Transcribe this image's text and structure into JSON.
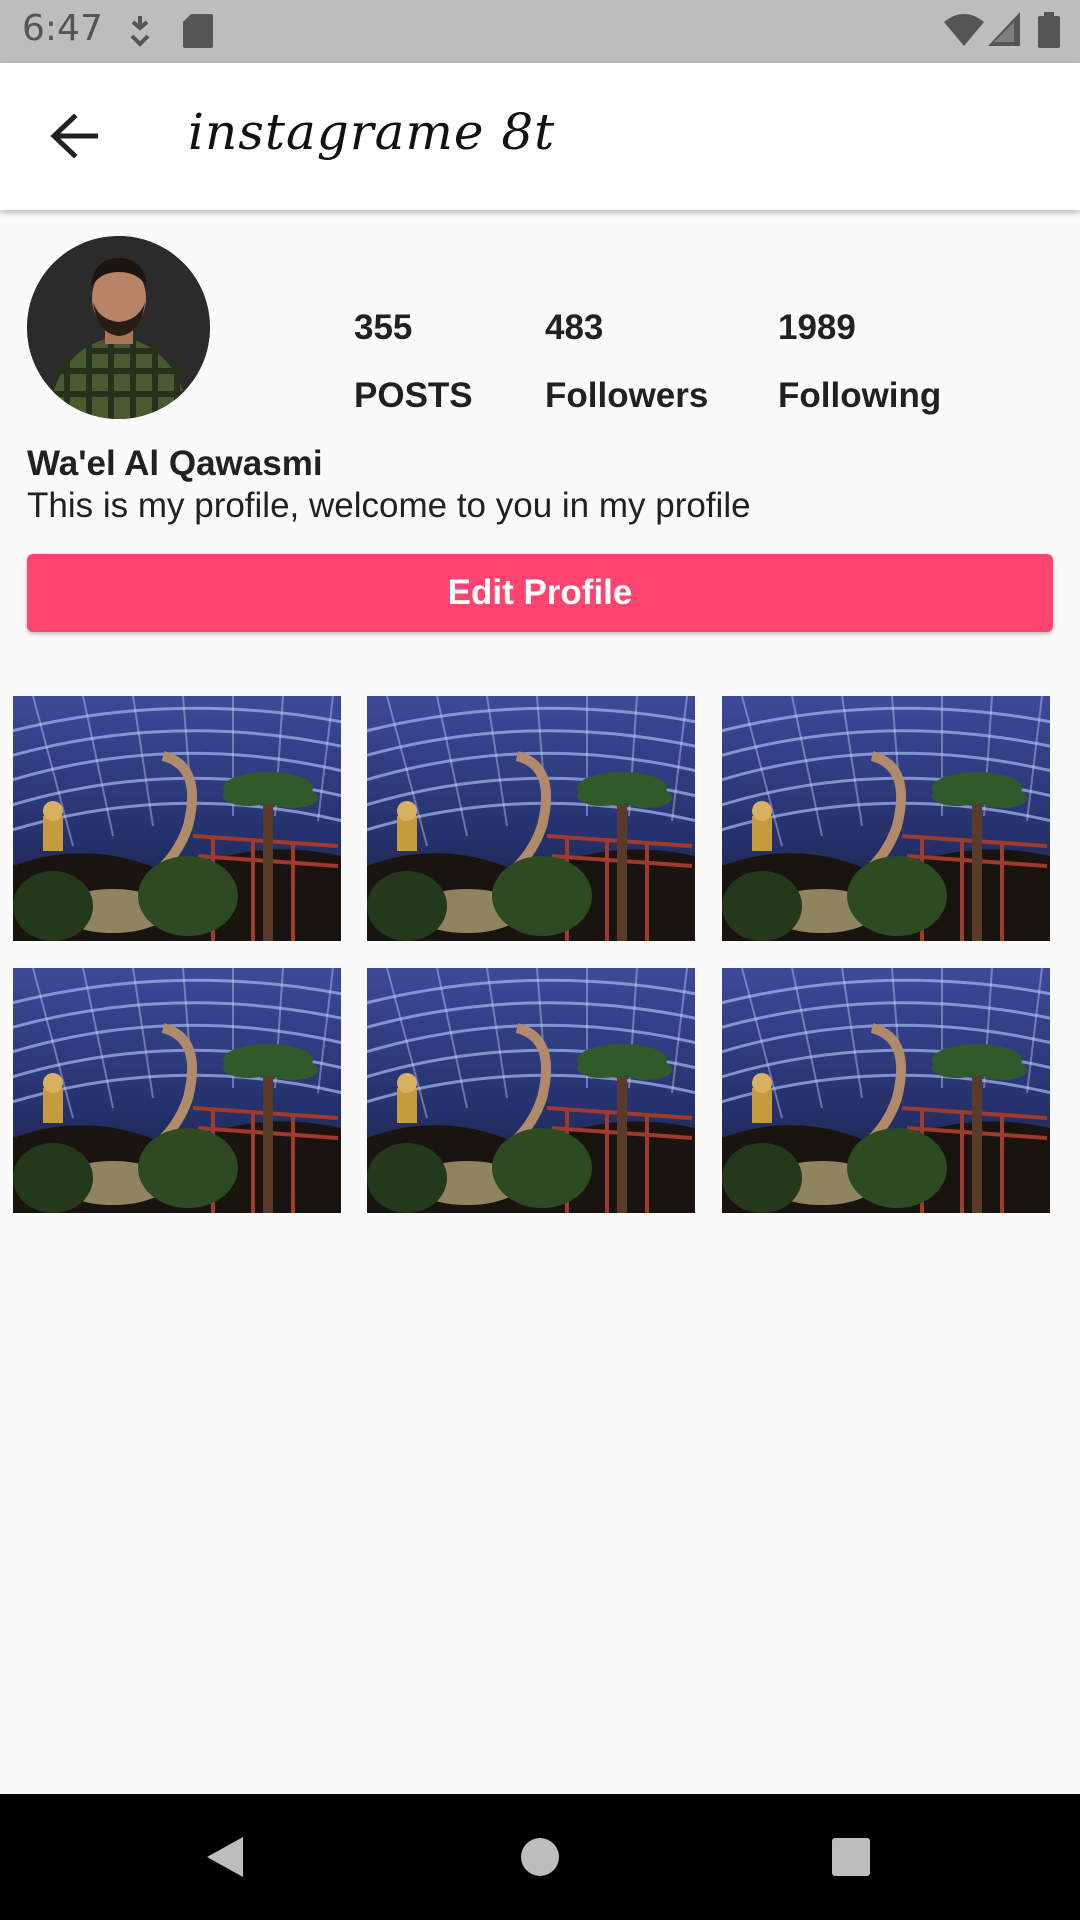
{
  "status_bar": {
    "time": "6:47",
    "icons": [
      "download-icon",
      "sd-card-icon",
      "wifi-icon",
      "signal-icon",
      "battery-icon"
    ]
  },
  "app_bar": {
    "title": "instagrame 8t",
    "back_icon": "arrow-back-icon"
  },
  "profile": {
    "stats": [
      {
        "value": "355",
        "label": "POSTS"
      },
      {
        "value": "483",
        "label": "Followers"
      },
      {
        "value": "1989",
        "label": "Following"
      }
    ],
    "name": "Wa'el Al Qawasmi",
    "bio": "This is my profile, welcome to you in my profile",
    "edit_button_label": "Edit Profile"
  },
  "posts": [
    {
      "id": "post-1"
    },
    {
      "id": "post-2"
    },
    {
      "id": "post-3"
    },
    {
      "id": "post-4"
    },
    {
      "id": "post-5"
    },
    {
      "id": "post-6"
    }
  ],
  "nav_bar": {
    "buttons": [
      "back-triangle-icon",
      "home-circle-icon",
      "recents-square-icon"
    ]
  },
  "colors": {
    "accent": "#ff4470",
    "status_bar": "#bdbdbd",
    "background": "#fafafa"
  }
}
